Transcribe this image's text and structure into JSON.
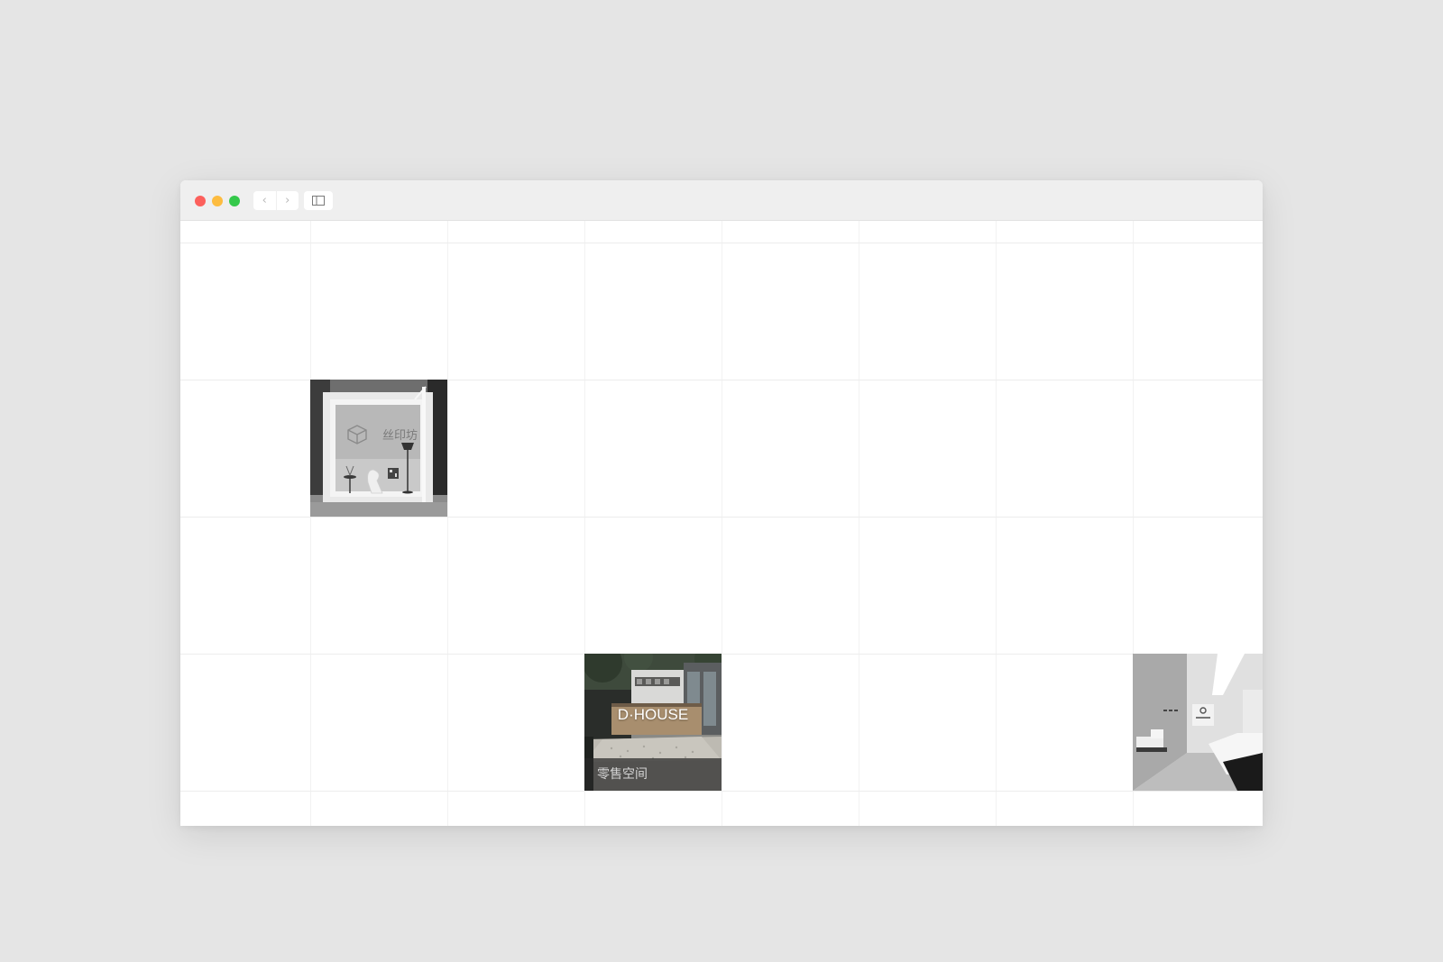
{
  "window": {
    "nav": {
      "back_icon": "‹",
      "forward_icon": "›"
    }
  },
  "grid": {
    "columns": 8,
    "rows": 5
  },
  "tiles": [
    {
      "id": "exhibition-booth",
      "image_text": "丝印坊"
    },
    {
      "id": "d-house",
      "title": "D·HOUSE",
      "caption": "零售空间"
    },
    {
      "id": "white-showroom",
      "image_text": ""
    }
  ]
}
